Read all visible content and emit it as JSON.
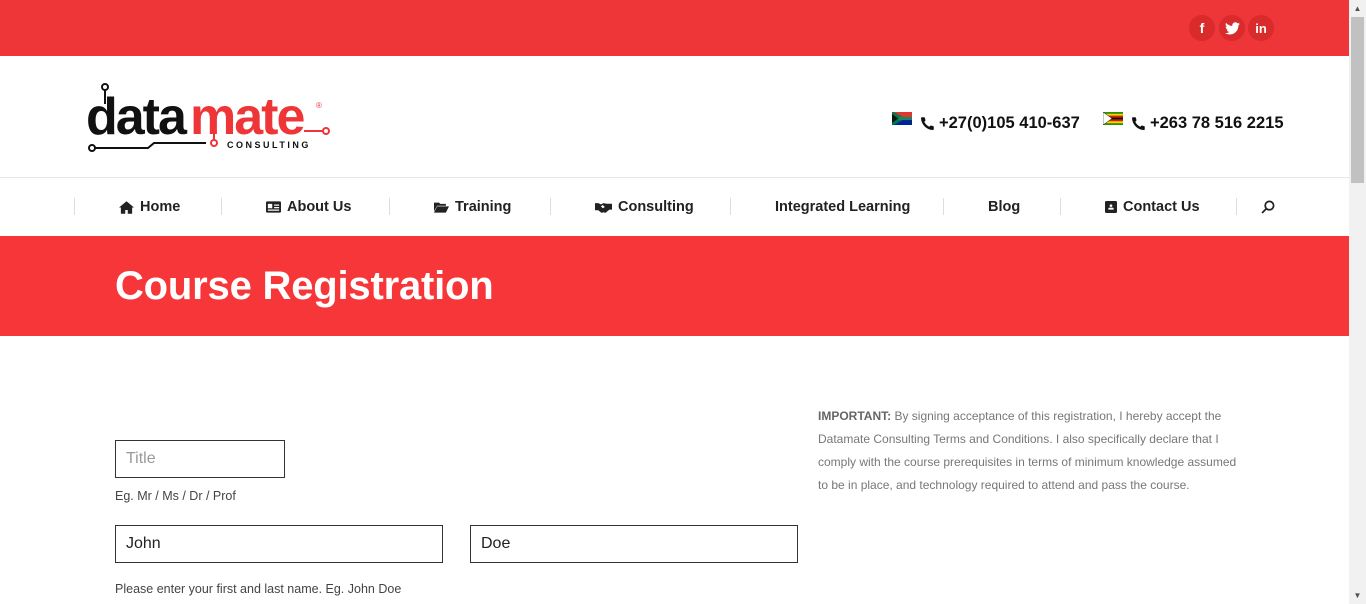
{
  "colors": {
    "accent": "#ee3537",
    "banner": "#f63638",
    "text": "#222222"
  },
  "topbar": {
    "social": [
      {
        "name": "facebook-icon",
        "glyph": "f"
      },
      {
        "name": "twitter-icon",
        "glyph": "t"
      },
      {
        "name": "linkedin-icon",
        "glyph": "in"
      }
    ]
  },
  "header": {
    "logo": {
      "main_dark": "data",
      "main_red": "mate",
      "sub": "CONSULTING",
      "registered": "®"
    },
    "phones": [
      {
        "flag": "south-africa-flag",
        "icon": "phone-icon",
        "number": "+27(0)105 410-637"
      },
      {
        "flag": "zimbabwe-flag",
        "icon": "phone-icon",
        "number": "+263 78 516 2215"
      }
    ]
  },
  "nav": {
    "items": [
      {
        "label": "Home",
        "icon": "home-icon"
      },
      {
        "label": "About Us",
        "icon": "id-card-icon"
      },
      {
        "label": "Training",
        "icon": "folder-open-icon"
      },
      {
        "label": "Consulting",
        "icon": "handshake-icon"
      },
      {
        "label": "Integrated Learning",
        "icon": ""
      },
      {
        "label": "Blog",
        "icon": ""
      },
      {
        "label": "Contact Us",
        "icon": "contact-icon"
      }
    ],
    "search_icon": "search-icon"
  },
  "banner": {
    "title": "Course Registration"
  },
  "form": {
    "title_field": {
      "placeholder": "Title",
      "value": ""
    },
    "title_hint": "Eg. Mr / Ms / Dr / Prof",
    "first_name": {
      "value": "John"
    },
    "last_name": {
      "value": "Doe"
    },
    "name_hint": "Please enter your first and last name. Eg. John Doe"
  },
  "notice": {
    "label": "IMPORTANT:",
    "text": " By signing acceptance of this registration, I hereby accept the Datamate  Consulting Terms and Conditions. I also specifically declare that I comply with the course prerequisites in terms of minimum knowledge assumed to be in place, and technology required to attend and pass the course."
  }
}
